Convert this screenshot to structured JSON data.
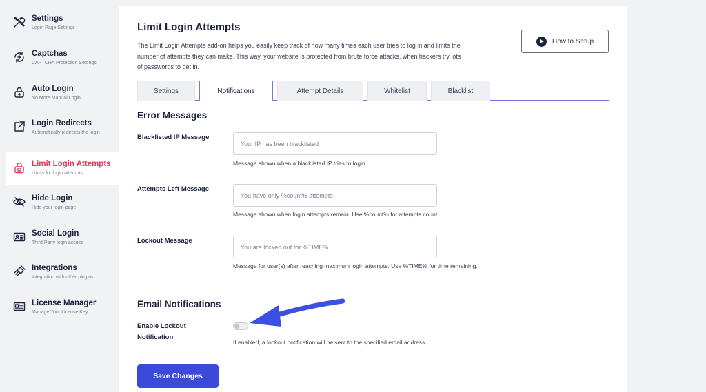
{
  "sidebar": {
    "items": [
      {
        "icon": "tools-icon",
        "title": "Settings",
        "subtitle": "Login Page Settings"
      },
      {
        "icon": "captcha-icon",
        "title": "Captchas",
        "subtitle": "CAPTCHA Protection Settings"
      },
      {
        "icon": "lock-icon",
        "title": "Auto Login",
        "subtitle": "No More Manual Login"
      },
      {
        "icon": "external-link-icon",
        "title": "Login Redirects",
        "subtitle": "Automatically redirects the login"
      },
      {
        "icon": "padlock-icon",
        "title": "Limit Login Attempts",
        "subtitle": "Limits for login attempts",
        "active": true
      },
      {
        "icon": "eye-slash-icon",
        "title": "Hide Login",
        "subtitle": "Hide your login page"
      },
      {
        "icon": "id-card-icon",
        "title": "Social Login",
        "subtitle": "Third Party login access"
      },
      {
        "icon": "plug-icon",
        "title": "Integrations",
        "subtitle": "Integration with other plugins"
      },
      {
        "icon": "license-icon",
        "title": "License Manager",
        "subtitle": "Manage Your License Key"
      }
    ]
  },
  "header": {
    "title": "Limit Login Attempts",
    "description": "The Limit Login Attempts add-on helps you easily keep track of how many times each user tries to log in and limits the number of attempts they can make. This way, your website is protected from brute force attacks, when hackers try lots of passwords to get in.",
    "setup_button": "How to Setup"
  },
  "tabs": [
    {
      "label": "Settings"
    },
    {
      "label": "Notifications",
      "active": true
    },
    {
      "label": "Attempt Details"
    },
    {
      "label": "Whitelist"
    },
    {
      "label": "Blacklist"
    }
  ],
  "error_messages": {
    "title": "Error Messages",
    "fields": [
      {
        "label": "Blacklisted IP Message",
        "placeholder": "Your IP has been blacklisted",
        "help": "Message shown when a blacklisted IP tries to login"
      },
      {
        "label": "Attempts Left Message",
        "placeholder": "You have only %count% attempts",
        "help": "Message shown when login attempts remain. Use %count% for attempts count."
      },
      {
        "label": "Lockout Message",
        "placeholder": "You are locked out for %TIME%",
        "help": "Message for user(s) after reaching maximum login attempts. Use %TIME% for time remaining."
      }
    ]
  },
  "email_notifications": {
    "title": "Email Notifications",
    "toggle_label": "Enable Lockout Notification",
    "toggle_on": false,
    "toggle_help": "If enabled, a lockout notification will be sent to the specified email address."
  },
  "save_button": "Save Changes",
  "colors": {
    "accent": "#3b4ad8",
    "active_sidebar": "#e2395b",
    "annotation_arrow": "#3b4fe0"
  }
}
